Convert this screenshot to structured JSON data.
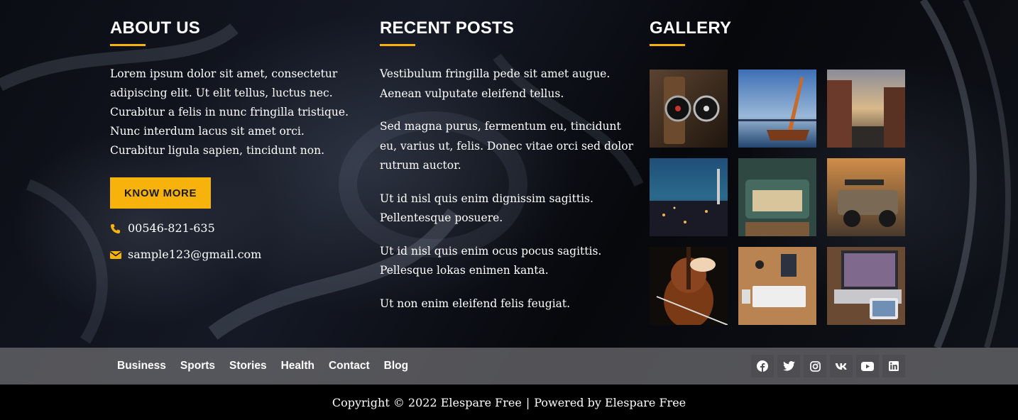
{
  "about": {
    "heading": "ABOUT US",
    "text": "Lorem ipsum dolor sit amet, consectetur adipiscing elit. Ut elit tellus, luctus nec. Curabitur a felis in nunc fringilla tristique. Nunc interdum lacus sit amet orci. Curabitur ligula sapien, tincidunt non.",
    "button_label": "KNOW MORE",
    "phone": "00546-821-635",
    "email": "sample123@gmail.com",
    "phone_icon": "phone-icon",
    "email_icon": "envelope-icon"
  },
  "recent_posts": {
    "heading": "RECENT POSTS",
    "items": [
      "Vestibulum fringilla pede sit amet augue. Aenean vulputate eleifend tellus.",
      "Sed magna purus, fermentum eu, tincidunt eu, varius ut, felis. Donec vitae orci sed dolor rutrum auctor.",
      "Ut id nisl quis enim dignissim sagittis. Pellentesque posuere.",
      "Ut id nisl quis enim ocus pocus sagittis. Pellesque lokas enimen kanta.",
      "Ut non enim eleifend felis feugiat."
    ]
  },
  "gallery": {
    "heading": "GALLERY"
  },
  "nav": {
    "links": [
      "Business",
      "Sports",
      "Stories",
      "Health",
      "Contact",
      "Blog"
    ]
  },
  "socials": [
    "facebook-icon",
    "twitter-icon",
    "instagram-icon",
    "vk-icon",
    "youtube-icon",
    "linkedin-icon"
  ],
  "footer": {
    "copyright": "Copyright © 2022 Elespare Free",
    "separator": "|",
    "powered": "Powered by Elespare Free"
  },
  "colors": {
    "accent": "#f7b30b",
    "navbar": "#646468",
    "social_bg": "#4e4e52",
    "footer_bg": "#000000"
  }
}
